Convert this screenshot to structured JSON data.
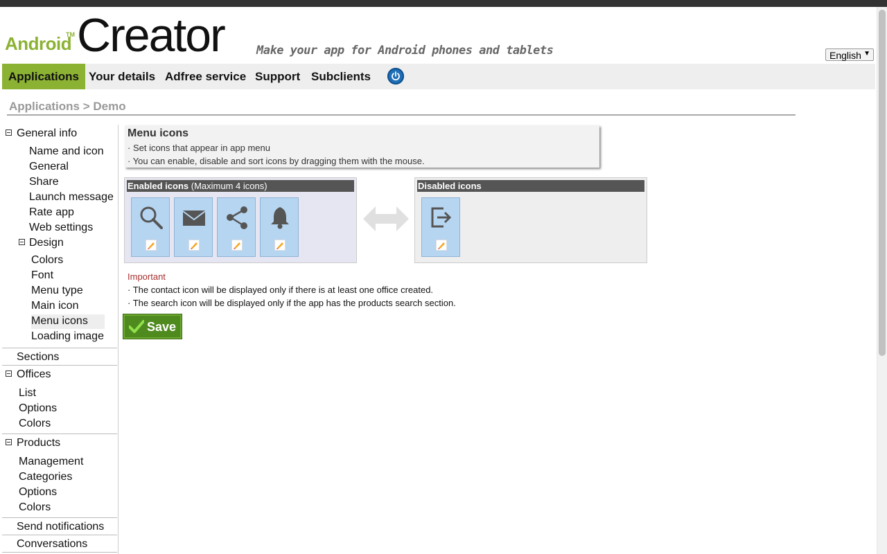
{
  "header": {
    "logo_android": "Android",
    "logo_tm": "TM",
    "logo_creator": "Creator",
    "tagline": "Make your app for Android phones and tablets",
    "language": "English"
  },
  "nav": {
    "items": [
      {
        "label": "Applications",
        "active": true
      },
      {
        "label": "Your details"
      },
      {
        "label": "Adfree service"
      },
      {
        "label": "Support"
      },
      {
        "label": "Subclients"
      }
    ],
    "power_icon": "power-icon"
  },
  "breadcrumb": "Applications > Demo",
  "sidebar": {
    "general_info": "General info",
    "name_and_icon": "Name and icon",
    "general": "General",
    "share": "Share",
    "launch_message": "Launch message",
    "rate_app": "Rate app",
    "web_settings": "Web settings",
    "design": "Design",
    "colors": "Colors",
    "font": "Font",
    "menu_type": "Menu type",
    "main_icon": "Main icon",
    "menu_icons": "Menu icons",
    "loading_image": "Loading image",
    "sections": "Sections",
    "offices": "Offices",
    "offices_list": "List",
    "offices_options": "Options",
    "offices_colors": "Colors",
    "products": "Products",
    "products_management": "Management",
    "products_categories": "Categories",
    "products_options": "Options",
    "products_colors": "Colors",
    "send_notifications": "Send notifications",
    "conversations": "Conversations"
  },
  "info": {
    "title": "Menu icons",
    "line1": "· Set icons that appear in app menu",
    "line2": "· You can enable, disable and sort icons by dragging them with the mouse."
  },
  "enabled_panel": {
    "title": "Enabled icons",
    "subtitle": "(Maximum 4 icons)",
    "icons": [
      "search-icon",
      "mail-icon",
      "share-icon",
      "bell-icon"
    ]
  },
  "disabled_panel": {
    "title": "Disabled icons",
    "icons": [
      "exit-icon"
    ]
  },
  "important": {
    "title": "Important",
    "line1": "· The contact icon will be displayed only if there is at least one office created.",
    "line2": "· The search icon will be displayed only if the app has the products search section."
  },
  "save_label": "Save",
  "colors": {
    "accent_green": "#8cb233",
    "save_green": "#4f8a1e",
    "tile_blue": "#b6d5f1",
    "important_red": "#a83030"
  }
}
